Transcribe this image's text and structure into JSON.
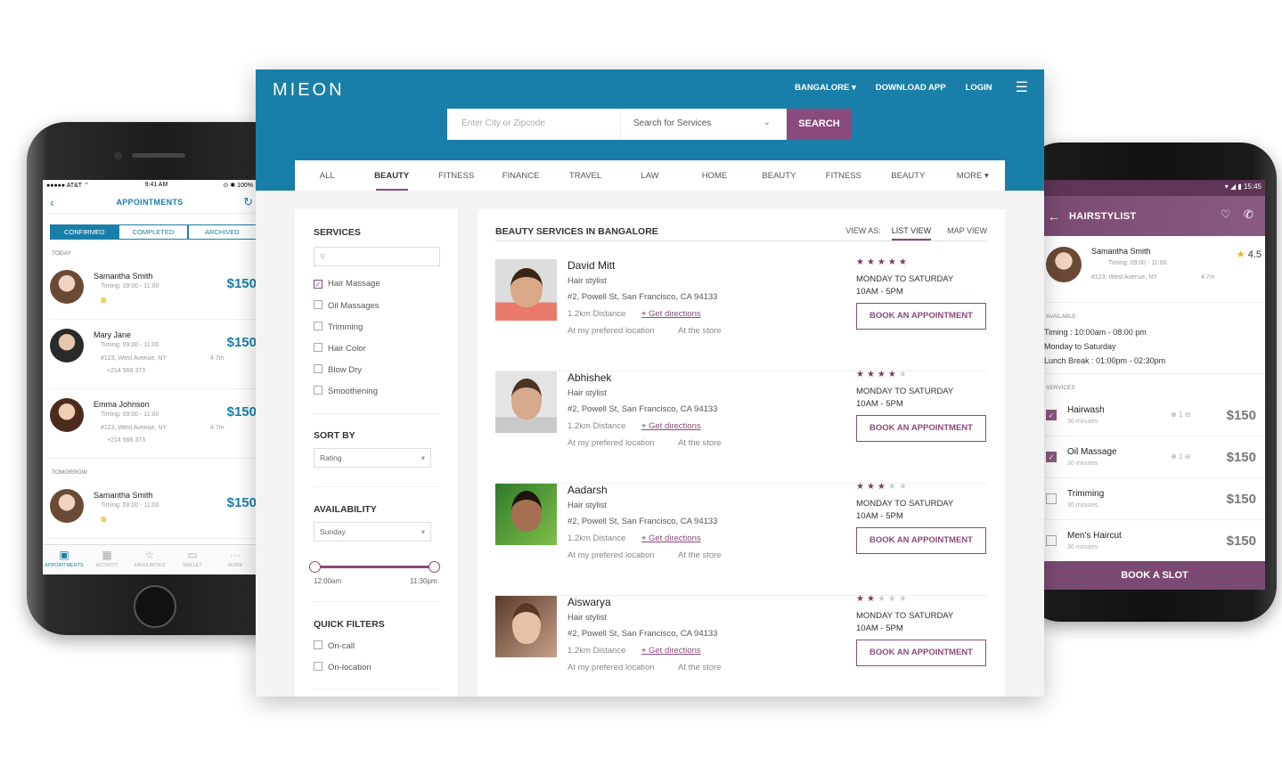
{
  "iphone": {
    "status": {
      "carrier": "●●●●● AT&T ⌔",
      "time": "9:41 AM",
      "battery": "⊙ ✱ 100%"
    },
    "title": "APPOINTMENTS",
    "segments": [
      "CONFIRMED",
      "COMPLETED",
      "ARCHIVED"
    ],
    "today_label": "TODAY",
    "tomorrow_label": "TOMORROW",
    "rows": [
      {
        "name": "Samantha Smith",
        "timing": "Timing: 09:00 - 11:00",
        "price": "$150",
        "address": "",
        "phone": "",
        "distance": ""
      },
      {
        "name": "Mary Jane",
        "timing": "Timing: 09:00 - 11:00",
        "price": "$150",
        "address": "#123, West Avenue, NY",
        "phone": "+214 566 373",
        "distance": "4.7m"
      },
      {
        "name": "Emma Johnson",
        "timing": "Timing: 09:00 - 11:00",
        "price": "$150",
        "address": "#123, West Avenue, NY",
        "phone": "+214 566 373",
        "distance": "4.7m"
      },
      {
        "name": "Samantha Smith",
        "timing": "Timing: 09:00 - 11:00",
        "price": "$150",
        "address": "",
        "phone": "",
        "distance": ""
      }
    ],
    "tabbar": [
      "APPOINTMENTS",
      "ACTIVITY",
      "FAVOURITES",
      "WALLET",
      "MORE"
    ]
  },
  "android": {
    "time": "15:45",
    "title": "HAIRSTYLIST",
    "profile": {
      "name": "Samantha Smith",
      "timing": "Timing: 09:00 - 11:00",
      "address": "#123, West Avenue, NY",
      "distance": "4.7m",
      "rating": "4.5"
    },
    "available_label": "AVAILABLE",
    "timing": "Timing : 10:00am - 08:00 pm",
    "days": "Monday to Saturday",
    "lunch": "Lunch Break : 01:00pm - 02:30pm",
    "services_label": "SERVICES",
    "services": [
      {
        "name": "Hairwash",
        "duration": "30 minutes",
        "qty": "1",
        "price": "$150",
        "checked": true
      },
      {
        "name": "Oil Massage",
        "duration": "30 minutes",
        "qty": "1",
        "price": "$150",
        "checked": true
      },
      {
        "name": "Trimming",
        "duration": "30 minutes",
        "qty": "",
        "price": "$150",
        "checked": false
      },
      {
        "name": "Men's Haircut",
        "duration": "30 minutes",
        "qty": "",
        "price": "$150",
        "checked": false
      }
    ],
    "book_label": "BOOK A SLOT"
  },
  "desktop": {
    "logo": "MIEON",
    "nav": {
      "city": "BANGALORE",
      "download": "DOWNLOAD APP",
      "login": "LOGIN"
    },
    "search": {
      "city_placeholder": "Enter City or Zipcode",
      "service_placeholder": "Search for Services",
      "button": "SEARCH"
    },
    "tabs": [
      "ALL",
      "BEAUTY",
      "FITNESS",
      "FINANCE",
      "TRAVEL",
      "LAW",
      "HOME",
      "BEAUTY",
      "FITNESS",
      "BEAUTY",
      "MORE"
    ],
    "sidebar": {
      "services_title": "SERVICES",
      "services": [
        {
          "label": "Hair Massage",
          "checked": true
        },
        {
          "label": "Oil Massages",
          "checked": false
        },
        {
          "label": "Trimming",
          "checked": false
        },
        {
          "label": "Hair Color",
          "checked": false
        },
        {
          "label": "Blow Dry",
          "checked": false
        },
        {
          "label": "Smoothening",
          "checked": false
        }
      ],
      "sort_title": "SORT BY",
      "sort_value": "Rating",
      "availability_title": "AVAILABILITY",
      "availability_value": "Sunday",
      "time_start": "12:00am",
      "time_end": "11:30pm",
      "quick_title": "QUICK FILTERS",
      "quick": [
        "On-call",
        "On-location"
      ]
    },
    "main": {
      "title": "BEAUTY SERVICES IN BANGALORE",
      "view_as": "VIEW AS:",
      "list_view": "LIST VIEW",
      "map_view": "MAP VIEW",
      "role": "Hair stylist",
      "address": "#2, Powell St, San Francisco, CA 94133",
      "distance": "1.2km Distance",
      "directions": "Get directions",
      "loc1": "At my prefered location",
      "loc2": "At the store",
      "days": "MONDAY TO SATURDAY",
      "hours": "10AM - 5PM",
      "book": "BOOK AN APPOINTMENT",
      "providers": [
        {
          "name": "David Mitt",
          "rating": 5
        },
        {
          "name": "Abhishek",
          "rating": 4
        },
        {
          "name": "Aadarsh",
          "rating": 3
        },
        {
          "name": "Aiswarya",
          "rating": 2
        }
      ]
    }
  },
  "colors": {
    "primary": "#1a7fa8",
    "accent": "#8a4a7c"
  }
}
